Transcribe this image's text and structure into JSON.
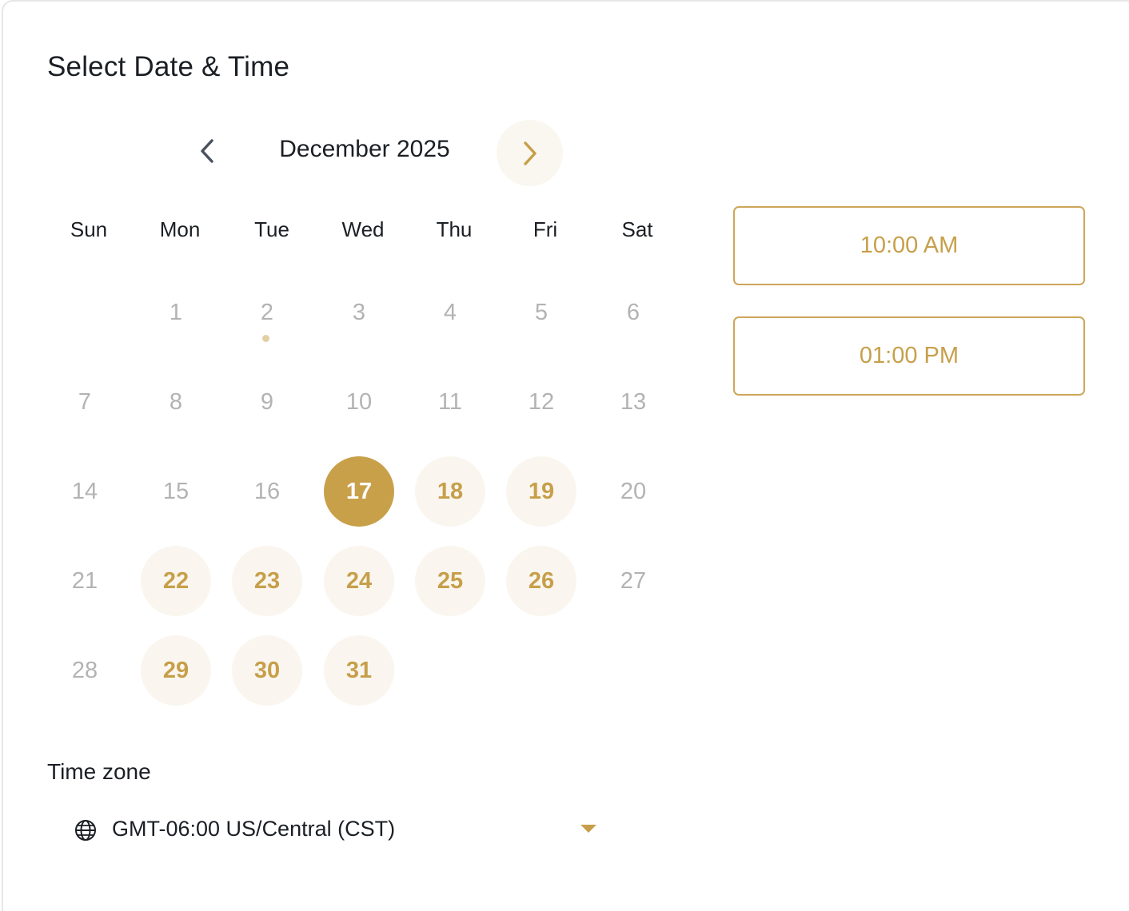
{
  "header": {
    "title": "Select Date & Time"
  },
  "calendar": {
    "month_label": "December 2025",
    "weekdays": [
      "Sun",
      "Mon",
      "Tue",
      "Wed",
      "Thu",
      "Fri",
      "Sat"
    ],
    "first_weekday_index": 1,
    "days_in_month": 31,
    "today": 2,
    "selected_day": 17,
    "available_days": [
      18,
      19,
      22,
      23,
      24,
      25,
      26,
      29,
      30,
      31
    ],
    "icons": {
      "prev": "chevron-left-icon",
      "next": "chevron-right-icon"
    }
  },
  "time_slots": [
    {
      "label": "10:00 AM"
    },
    {
      "label": "01:00 PM"
    }
  ],
  "timezone": {
    "label": "Time zone",
    "value": "GMT-06:00 US/Central (CST)",
    "icon": "globe-icon",
    "caret_icon": "caret-down-icon"
  },
  "colors": {
    "accent": "#c9a04a",
    "accent_text": "#c79f4a",
    "available_bg": "#faf6ef",
    "disabled_text": "#b3b3b3",
    "text": "#1b1f24"
  }
}
